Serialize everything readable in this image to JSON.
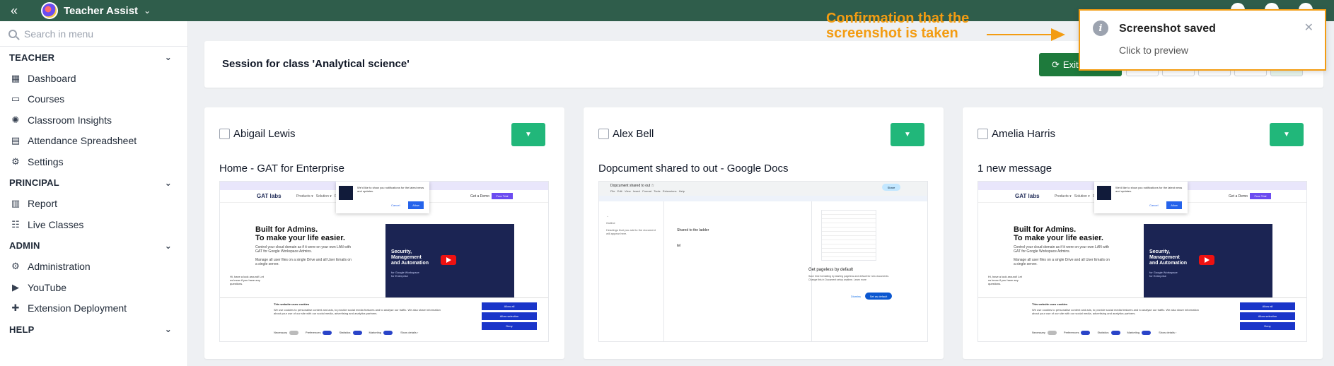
{
  "app": {
    "title": "Teacher Assist",
    "collapse_icon": "double-chevron-left-icon"
  },
  "sidebar": {
    "search_placeholder": "Search in menu",
    "sections": [
      {
        "title": "TEACHER",
        "items": [
          {
            "label": "Dashboard",
            "icon": "dashboard-icon"
          },
          {
            "label": "Courses",
            "icon": "courses-icon"
          },
          {
            "label": "Classroom Insights",
            "icon": "lightbulb-icon"
          },
          {
            "label": "Attendance Spreadsheet",
            "icon": "spreadsheet-icon"
          },
          {
            "label": "Settings",
            "icon": "gear-icon"
          }
        ]
      },
      {
        "title": "PRINCIPAL",
        "items": [
          {
            "label": "Report",
            "icon": "report-icon"
          },
          {
            "label": "Live Classes",
            "icon": "live-classes-icon"
          }
        ]
      },
      {
        "title": "ADMIN",
        "items": [
          {
            "label": "Administration",
            "icon": "gear-icon"
          },
          {
            "label": "YouTube",
            "icon": "youtube-icon"
          },
          {
            "label": "Extension Deployment",
            "icon": "puzzle-icon"
          }
        ]
      },
      {
        "title": "HELP",
        "items": []
      }
    ]
  },
  "session": {
    "title": "Session for class 'Analytical science'",
    "exit_label": "Exit"
  },
  "students": [
    {
      "name": "Abigail Lewis",
      "tab_title": "Home - GAT for Enterprise"
    },
    {
      "name": "Alex Bell",
      "tab_title": "Dopcument shared to out - Google Docs"
    },
    {
      "name": "Amelia Harris",
      "tab_title": "1 new message"
    }
  ],
  "annotation": {
    "text_line1": "Confirmation that the",
    "text_line2": "screenshot is taken"
  },
  "toast": {
    "title": "Screenshot saved",
    "subtitle": "Click to preview"
  },
  "colors": {
    "topbar": "#2f5d4b",
    "accent_green": "#21b77a",
    "exit_green": "#1e7a3c",
    "annotation": "#f39c12"
  }
}
